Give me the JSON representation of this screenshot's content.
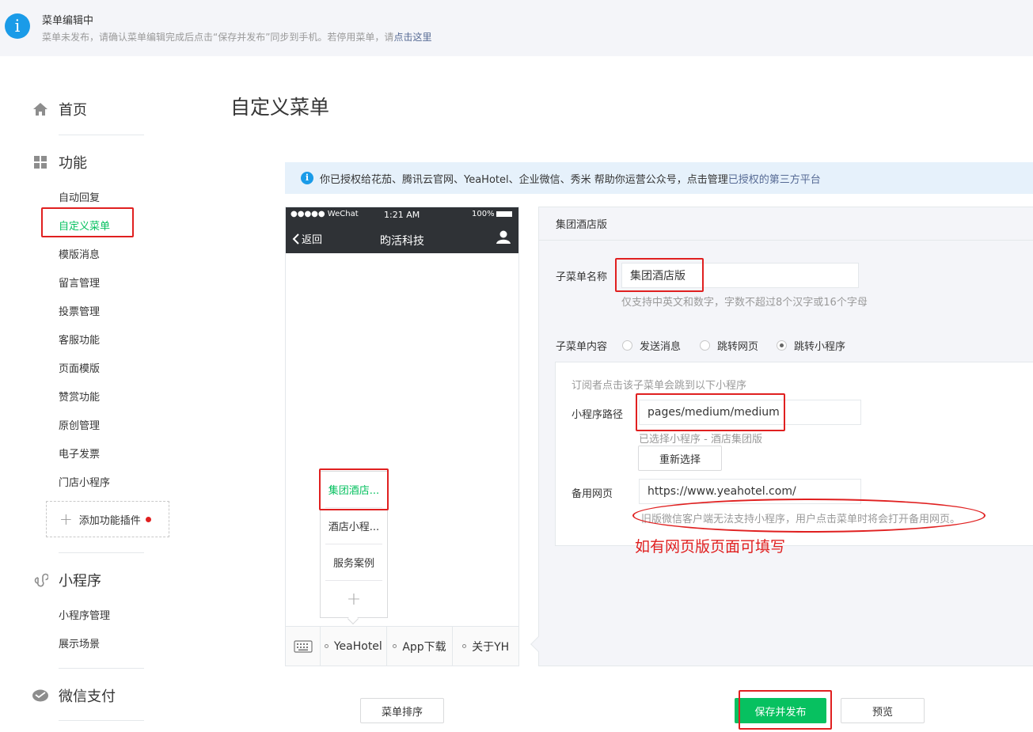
{
  "notice": {
    "title": "菜单编辑中",
    "text": "菜单未发布，请确认菜单编辑完成后点击“保存并发布”同步到手机。若停用菜单，请",
    "link": "点击这里"
  },
  "sidebar": {
    "home": "首页",
    "features": "功能",
    "feature_items": [
      "自动回复",
      "自定义菜单",
      "模版消息",
      "留言管理",
      "投票管理",
      "客服功能",
      "页面模版",
      "赞赏功能",
      "原创管理",
      "电子发票",
      "门店小程序"
    ],
    "add_plugin": "添加功能插件",
    "miniprogram": "小程序",
    "miniprogram_items": [
      "小程序管理",
      "展示场景"
    ],
    "wechat_pay": "微信支付"
  },
  "page_title": "自定义菜单",
  "auth_bar": {
    "text": "你已授权给花茄、腾讯云官网、YeaHotel、企业微信、秀米  帮助你运营公众号，点击管理",
    "link": "已授权的第三方平台"
  },
  "phone": {
    "signal": "●●●●● WeChat",
    "time": "1:21 AM",
    "battery": "100%",
    "back": "返回",
    "title": "昀活科技",
    "submenu": [
      "集团酒店...",
      "酒店小程...",
      "服务案例"
    ],
    "tabs": [
      "YeaHotel",
      "App下载",
      "关于YH"
    ]
  },
  "editor": {
    "header": "集团酒店版",
    "name_label": "子菜单名称",
    "name_value": "集团酒店版",
    "name_tip": "仅支持中英文和数字，字数不超过8个汉字或16个字母",
    "content_label": "子菜单内容",
    "radio_options": [
      "发送消息",
      "跳转网页",
      "跳转小程序"
    ],
    "sub_tip": "订阅者点击该子菜单会跳到以下小程序",
    "path_label": "小程序路径",
    "path_value": "pages/medium/medium",
    "selected_tip": "已选择小程序 - 酒店集团版",
    "reselect": "重新选择",
    "backup_label": "备用网页",
    "backup_value": "https://www.yeahotel.com/",
    "backup_tip": "旧版微信客户端无法支持小程序，用户点击菜单时将会打开备用网页。",
    "annotation": "如有网页版页面可填写"
  },
  "buttons": {
    "sort": "菜单排序",
    "save": "保存并发布",
    "preview": "预览"
  },
  "colors": {
    "accent": "#07c160",
    "annotation": "#e02020",
    "link": "#576b95"
  }
}
